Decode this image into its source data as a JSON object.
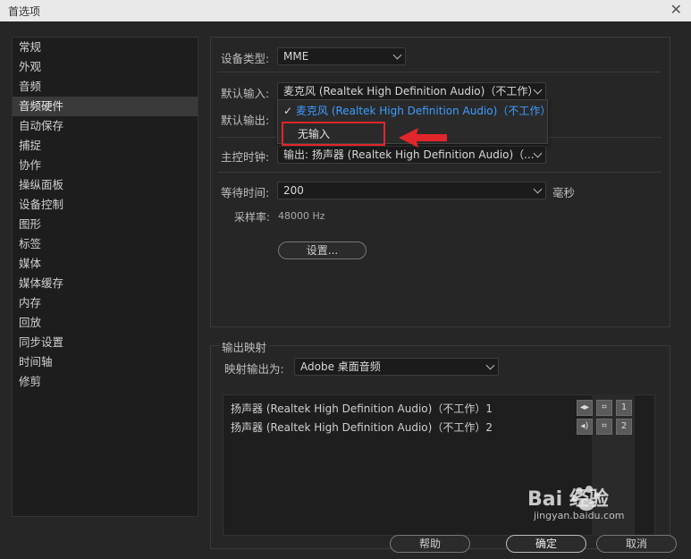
{
  "window": {
    "title": "首选项",
    "close_glyph": "✕"
  },
  "sidebar": {
    "items": [
      {
        "label": "常规"
      },
      {
        "label": "外观"
      },
      {
        "label": "音频"
      },
      {
        "label": "音频硬件"
      },
      {
        "label": "自动保存"
      },
      {
        "label": "捕捉"
      },
      {
        "label": "协作"
      },
      {
        "label": "操纵面板"
      },
      {
        "label": "设备控制"
      },
      {
        "label": "图形"
      },
      {
        "label": "标签"
      },
      {
        "label": "媒体"
      },
      {
        "label": "媒体缓存"
      },
      {
        "label": "内存"
      },
      {
        "label": "回放"
      },
      {
        "label": "同步设置"
      },
      {
        "label": "时间轴"
      },
      {
        "label": "修剪"
      }
    ],
    "active_index": 3
  },
  "hardware": {
    "device_type_label": "设备类型:",
    "device_type_value": "MME",
    "default_input_label": "默认输入:",
    "default_input_value": "麦克风 (Realtek High Definition Audio)（不工作）",
    "default_output_label": "默认输出:",
    "master_clock_label": "主控时钟:",
    "master_clock_value": "输出: 扬声器 (Realtek High Definition Audio)（...",
    "latency_label": "等待时间:",
    "latency_value": "200",
    "latency_unit": "毫秒",
    "sample_rate_label": "采样率:",
    "sample_rate_value": "48000 Hz",
    "settings_button": "设置..."
  },
  "dropdown": {
    "check_glyph": "✓",
    "selected_option": "麦克风 (Realtek High Definition Audio)（不工作）",
    "option_none": "无输入"
  },
  "output_mapping": {
    "section_title": "输出映射",
    "map_output_label": "映射输出为:",
    "map_output_value": "Adobe 桌面音频",
    "rows": [
      {
        "label": "扬声器 (Realtek High Definition Audio)（不工作）1",
        "channel": "1"
      },
      {
        "label": "扬声器 (Realtek High Definition Audio)（不工作）2",
        "channel": "2"
      }
    ]
  },
  "footer": {
    "help_button": "帮助",
    "ok_button": "确定",
    "cancel_button": "取消"
  },
  "watermark": {
    "brand": "Bai 经验",
    "url": "jingyan.baidu.com"
  },
  "colors": {
    "highlight_blue": "#3d9dff",
    "annotation_red": "#e0262a"
  }
}
